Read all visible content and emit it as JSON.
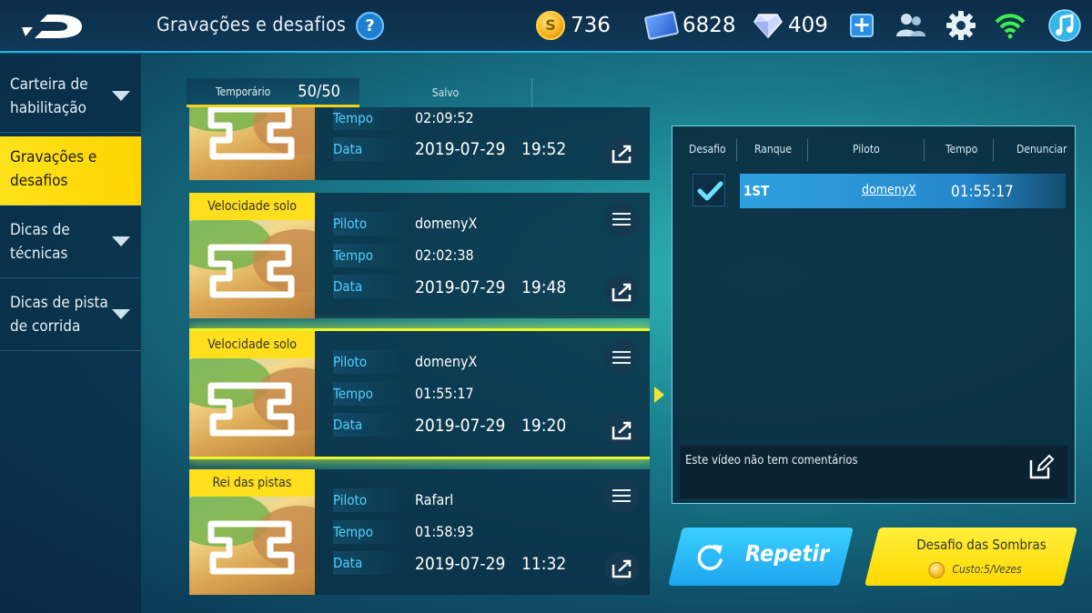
{
  "header": {
    "title": "Gravações e desafios",
    "help_icon": "question-icon",
    "help_label": "?",
    "coins": "736",
    "coin_label": "S",
    "cards": "6828",
    "gems": "409",
    "plus_label": "+",
    "icons": [
      "friends-icon",
      "gear-icon",
      "wifi-icon",
      "music-icon"
    ]
  },
  "sidebar": {
    "items": [
      {
        "label_line1": "Carteira de",
        "label_line2": "habilitação",
        "active": false,
        "expandable": true
      },
      {
        "label_line1": "Gravações e",
        "label_line2": "desafios",
        "active": true,
        "expandable": false
      },
      {
        "label_line1": "Dicas de",
        "label_line2": "técnicas",
        "active": false,
        "expandable": true
      },
      {
        "label_line1": "Dicas de pista",
        "label_line2": "de corrida",
        "active": false,
        "expandable": true
      }
    ]
  },
  "tabs": {
    "temp_label": "Temporário",
    "temp_count": "50/50",
    "saved_label": "Salvo"
  },
  "records": [
    {
      "mode": "",
      "piloto_label": "",
      "piloto": "",
      "tempo_label": "Tempo",
      "tempo": "02:09:52",
      "data_label": "Data",
      "date": "2019-07-29",
      "time": "19:52",
      "selected": false
    },
    {
      "mode": "Velocidade solo",
      "piloto_label": "Piloto",
      "piloto": "domenyX",
      "tempo_label": "Tempo",
      "tempo": "02:02:38",
      "data_label": "Data",
      "date": "2019-07-29",
      "time": "19:48",
      "selected": false
    },
    {
      "mode": "Velocidade solo",
      "piloto_label": "Piloto",
      "piloto": "domenyX",
      "tempo_label": "Tempo",
      "tempo": "01:55:17",
      "data_label": "Data",
      "date": "2019-07-29",
      "time": "19:20",
      "selected": true
    },
    {
      "mode": "Rei das pistas",
      "piloto_label": "Piloto",
      "piloto": "Rafarl",
      "tempo_label": "Tempo",
      "tempo": "01:58:93",
      "data_label": "Data",
      "date": "2019-07-29",
      "time": "11:32",
      "selected": false
    }
  ],
  "panel": {
    "headers": {
      "desafio": "Desafio",
      "ranque": "Ranque",
      "piloto": "Piloto",
      "tempo": "Tempo",
      "denunciar": "Denunciar"
    },
    "row": {
      "rank": "1ST",
      "piloto": "domenyX",
      "tempo": "01:55:17",
      "checked": true
    },
    "comment": "Este vídeo não tem comentários"
  },
  "buttons": {
    "repeat_label": "Repetir",
    "shadow_label": "Desafio das Sombras",
    "shadow_cost": "Custo:5/Vezes"
  },
  "colors": {
    "accent_yellow": "#ffdf1c",
    "accent_blue": "#2fa0e0",
    "label_cyan": "#4fd0ff"
  }
}
